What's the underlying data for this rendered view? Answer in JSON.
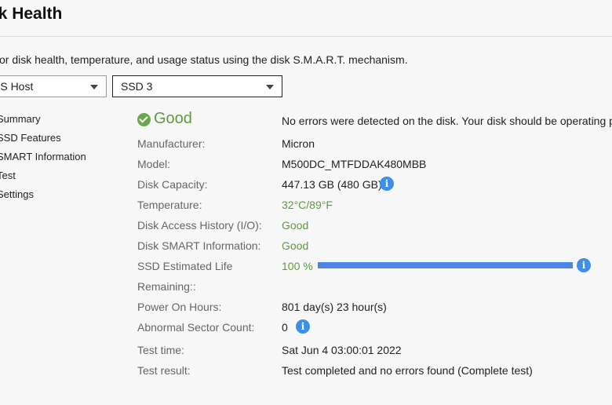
{
  "header": {
    "title": "sk Health",
    "description": "itor disk health, temperature, and usage status using the disk S.M.A.R.T. mechanism."
  },
  "selectors": {
    "host": "AS Host",
    "disk": "SSD 3"
  },
  "sidebar": {
    "items": [
      {
        "label": "Summary"
      },
      {
        "label": "SSD Features"
      },
      {
        "label": "SMART Information"
      },
      {
        "label": "Test"
      },
      {
        "label": "Settings"
      }
    ]
  },
  "summary": {
    "status": "Good",
    "message": "No errors were detected on the disk. Your disk should be operating prope",
    "manufacturer_label": "Manufacturer:",
    "manufacturer": "Micron",
    "model_label": "Model:",
    "model": "M500DC_MTFDDAK480MBB",
    "capacity_label": "Disk Capacity:",
    "capacity": "447.13 GB (480 GB)",
    "temperature_label": "Temperature:",
    "temperature": "32°C/89°F",
    "access_label": "Disk Access History (I/O):",
    "access": "Good",
    "smart_label": "Disk SMART Information:",
    "smart": "Good",
    "life_label_1": "SSD Estimated Life",
    "life_label_2": "Remaining::",
    "life": "100 %",
    "life_fraction": 1.0,
    "power_label": "Power On Hours:",
    "power": "801 day(s) 23 hour(s)",
    "sector_label": "Abnormal Sector Count:",
    "sector": "0",
    "test_time_label": "Test time:",
    "test_time": "Sat Jun 4 03:00:01 2022",
    "test_result_label": "Test result:",
    "test_result": "Test completed and no errors found (Complete test)",
    "info_glyph": "i"
  },
  "colors": {
    "good": "#5c9b3c",
    "accent": "#3d8fe8",
    "progress": "#4a86e8"
  }
}
